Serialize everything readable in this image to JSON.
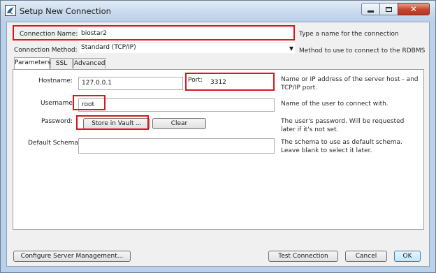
{
  "window": {
    "title": "Setup New Connection"
  },
  "connection_name": {
    "label": "Connection Name:",
    "value": "biostar2",
    "hint": "Type a name for the connection"
  },
  "connection_method": {
    "label": "Connection Method:",
    "value": "Standard (TCP/IP)",
    "hint": "Method to use to connect to the RDBMS"
  },
  "tabs": [
    {
      "label": "Parameters"
    },
    {
      "label": "SSL"
    },
    {
      "label": "Advanced"
    }
  ],
  "hostname": {
    "label": "Hostname:",
    "value": "127.0.0.1"
  },
  "port": {
    "label": "Port:",
    "value": "3312",
    "hint_line1": "Name or IP address of the server host - and",
    "hint_line2": "TCP/IP port."
  },
  "username": {
    "label": "Username:",
    "value": "root",
    "hint": "Name of the user to connect with."
  },
  "password": {
    "label": "Password:",
    "store_button": "Store in Vault ...",
    "clear_button": "Clear",
    "hint_line1": "The user's password. Will be requested",
    "hint_line2": "later if it's not set."
  },
  "default_schema": {
    "label": "Default Schema:",
    "value": "",
    "hint_line1": "The schema to use as default schema.",
    "hint_line2": "Leave blank to select it later."
  },
  "footer": {
    "configure_button": "Configure Server Management...",
    "test_button": "Test Connection",
    "cancel_button": "Cancel",
    "ok_button": "OK"
  },
  "colors": {
    "highlight": "#e0141e",
    "title_bar": "#c9daee",
    "dialog_bg": "#f0f0f0"
  },
  "icons": {
    "app": "mysql-dolphin-icon",
    "minimize": "minimize-icon",
    "maximize": "maximize-icon",
    "close": "close-icon",
    "dropdown": "chevron-down-icon"
  }
}
